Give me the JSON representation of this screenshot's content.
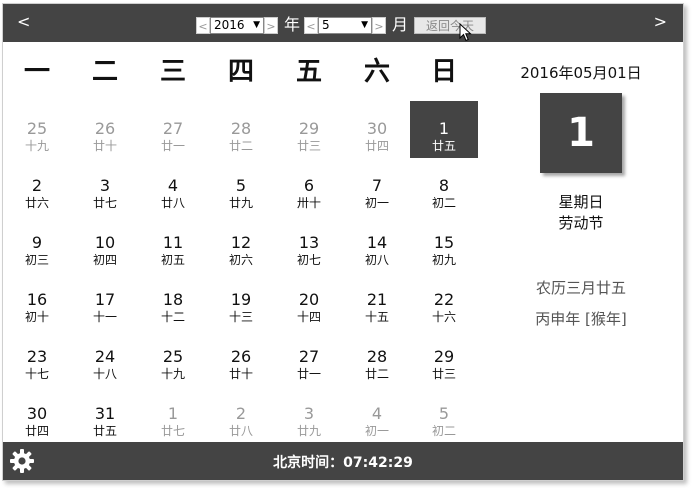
{
  "header": {
    "prev_month_label": "<",
    "next_month_label": ">",
    "year_prev": "<",
    "year_next": ">",
    "year_value": "2016",
    "year_unit": "年",
    "month_prev": "<",
    "month_next": ">",
    "month_value": "5",
    "month_unit": "月",
    "today_button": "返回今天"
  },
  "weekdays": [
    "一",
    "二",
    "三",
    "四",
    "五",
    "六",
    "日"
  ],
  "days": [
    {
      "d": "25",
      "l": "十九",
      "t": "other"
    },
    {
      "d": "26",
      "l": "廿十",
      "t": "other"
    },
    {
      "d": "27",
      "l": "廿一",
      "t": "other"
    },
    {
      "d": "28",
      "l": "廿二",
      "t": "other"
    },
    {
      "d": "29",
      "l": "廿三",
      "t": "other"
    },
    {
      "d": "30",
      "l": "廿四",
      "t": "other"
    },
    {
      "d": "1",
      "l": "廿五",
      "t": "selected"
    },
    {
      "d": "2",
      "l": "廿六",
      "t": "cur"
    },
    {
      "d": "3",
      "l": "廿七",
      "t": "cur"
    },
    {
      "d": "4",
      "l": "廿八",
      "t": "cur"
    },
    {
      "d": "5",
      "l": "廿九",
      "t": "cur"
    },
    {
      "d": "6",
      "l": "卅十",
      "t": "cur"
    },
    {
      "d": "7",
      "l": "初一",
      "t": "cur"
    },
    {
      "d": "8",
      "l": "初二",
      "t": "cur"
    },
    {
      "d": "9",
      "l": "初三",
      "t": "cur"
    },
    {
      "d": "10",
      "l": "初四",
      "t": "cur"
    },
    {
      "d": "11",
      "l": "初五",
      "t": "cur"
    },
    {
      "d": "12",
      "l": "初六",
      "t": "cur"
    },
    {
      "d": "13",
      "l": "初七",
      "t": "cur"
    },
    {
      "d": "14",
      "l": "初八",
      "t": "cur"
    },
    {
      "d": "15",
      "l": "初九",
      "t": "cur"
    },
    {
      "d": "16",
      "l": "初十",
      "t": "cur"
    },
    {
      "d": "17",
      "l": "十一",
      "t": "cur"
    },
    {
      "d": "18",
      "l": "十二",
      "t": "cur"
    },
    {
      "d": "19",
      "l": "十三",
      "t": "cur"
    },
    {
      "d": "20",
      "l": "十四",
      "t": "cur"
    },
    {
      "d": "21",
      "l": "十五",
      "t": "cur"
    },
    {
      "d": "22",
      "l": "十六",
      "t": "cur"
    },
    {
      "d": "23",
      "l": "十七",
      "t": "cur"
    },
    {
      "d": "24",
      "l": "十八",
      "t": "cur"
    },
    {
      "d": "25",
      "l": "十九",
      "t": "cur"
    },
    {
      "d": "26",
      "l": "廿十",
      "t": "cur"
    },
    {
      "d": "27",
      "l": "廿一",
      "t": "cur"
    },
    {
      "d": "28",
      "l": "廿二",
      "t": "cur"
    },
    {
      "d": "29",
      "l": "廿三",
      "t": "cur"
    },
    {
      "d": "30",
      "l": "廿四",
      "t": "cur"
    },
    {
      "d": "31",
      "l": "廿五",
      "t": "cur"
    },
    {
      "d": "1",
      "l": "廿七",
      "t": "other"
    },
    {
      "d": "2",
      "l": "廿八",
      "t": "other"
    },
    {
      "d": "3",
      "l": "廿九",
      "t": "other"
    },
    {
      "d": "4",
      "l": "初一",
      "t": "other"
    },
    {
      "d": "5",
      "l": "初二",
      "t": "other"
    }
  ],
  "detail": {
    "full_date": "2016年05月01日",
    "big_day": "1",
    "weekday": "星期日",
    "festival": "劳动节",
    "lunar_date": "农历三月廿五",
    "ganzhi_year": "丙申年 [猴年]"
  },
  "footer": {
    "clock": "北京时间：07:42:29"
  },
  "colors": {
    "bar": "#444444",
    "selected_bg": "#444444",
    "muted_text": "#999999"
  }
}
